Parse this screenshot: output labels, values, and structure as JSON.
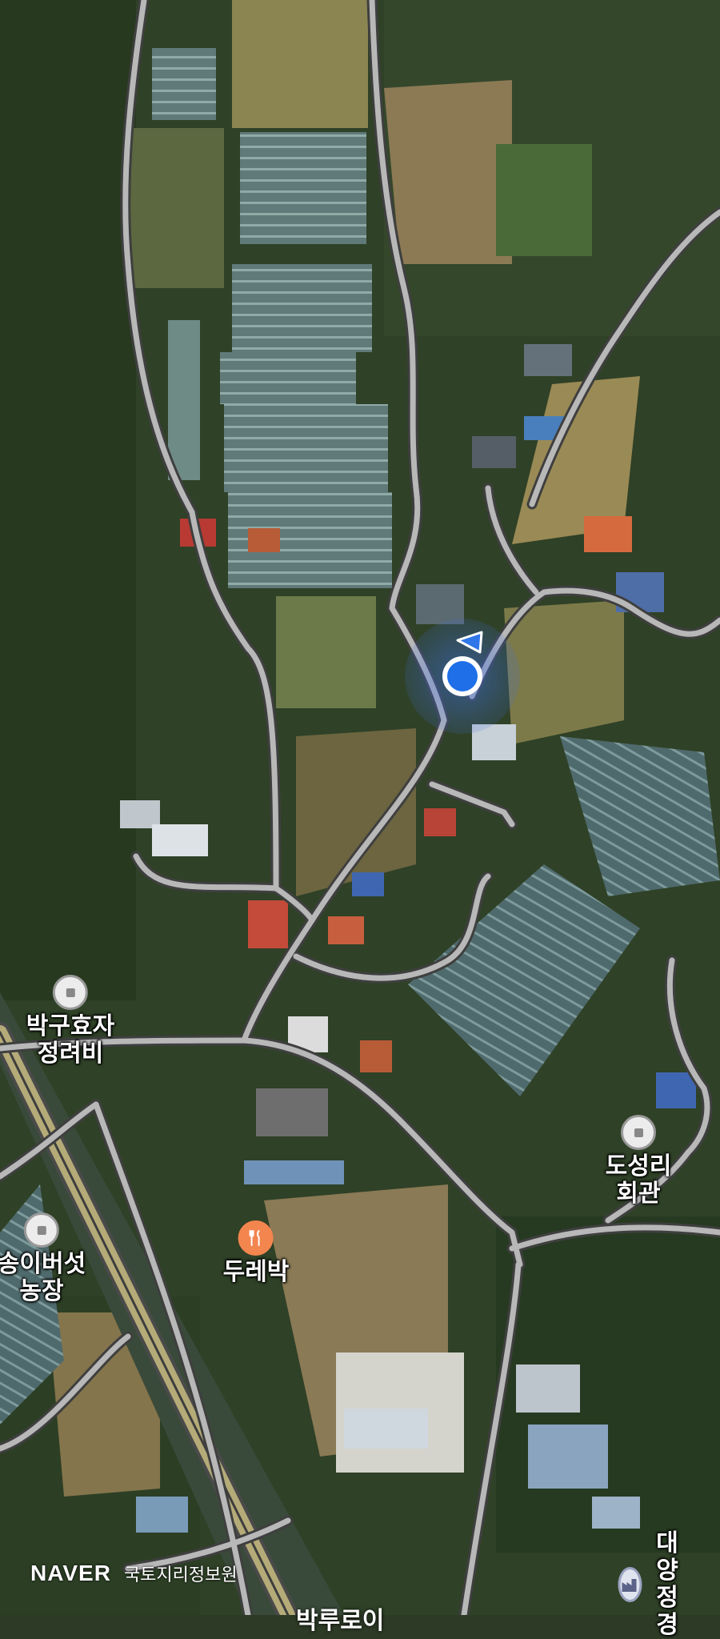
{
  "map": {
    "provider_logo": "NAVER",
    "attribution": "국토지리정보원",
    "location_marker": {
      "label": "current-location"
    },
    "pois": [
      {
        "id": "bakguhyoja",
        "label": "박구효자\n정려비",
        "icon": "landmark-pin"
      },
      {
        "id": "songibeoseot",
        "label": "송이버섯\n농장",
        "icon": "landmark-pin"
      },
      {
        "id": "dure",
        "label": "두레박",
        "icon": "restaurant-fork-knife"
      },
      {
        "id": "doseongri",
        "label": "도성리회관",
        "icon": "landmark-pin"
      },
      {
        "id": "daeyang",
        "label": "대양정경",
        "icon": "factory"
      }
    ],
    "bottom_partial_label": "박루로이"
  }
}
